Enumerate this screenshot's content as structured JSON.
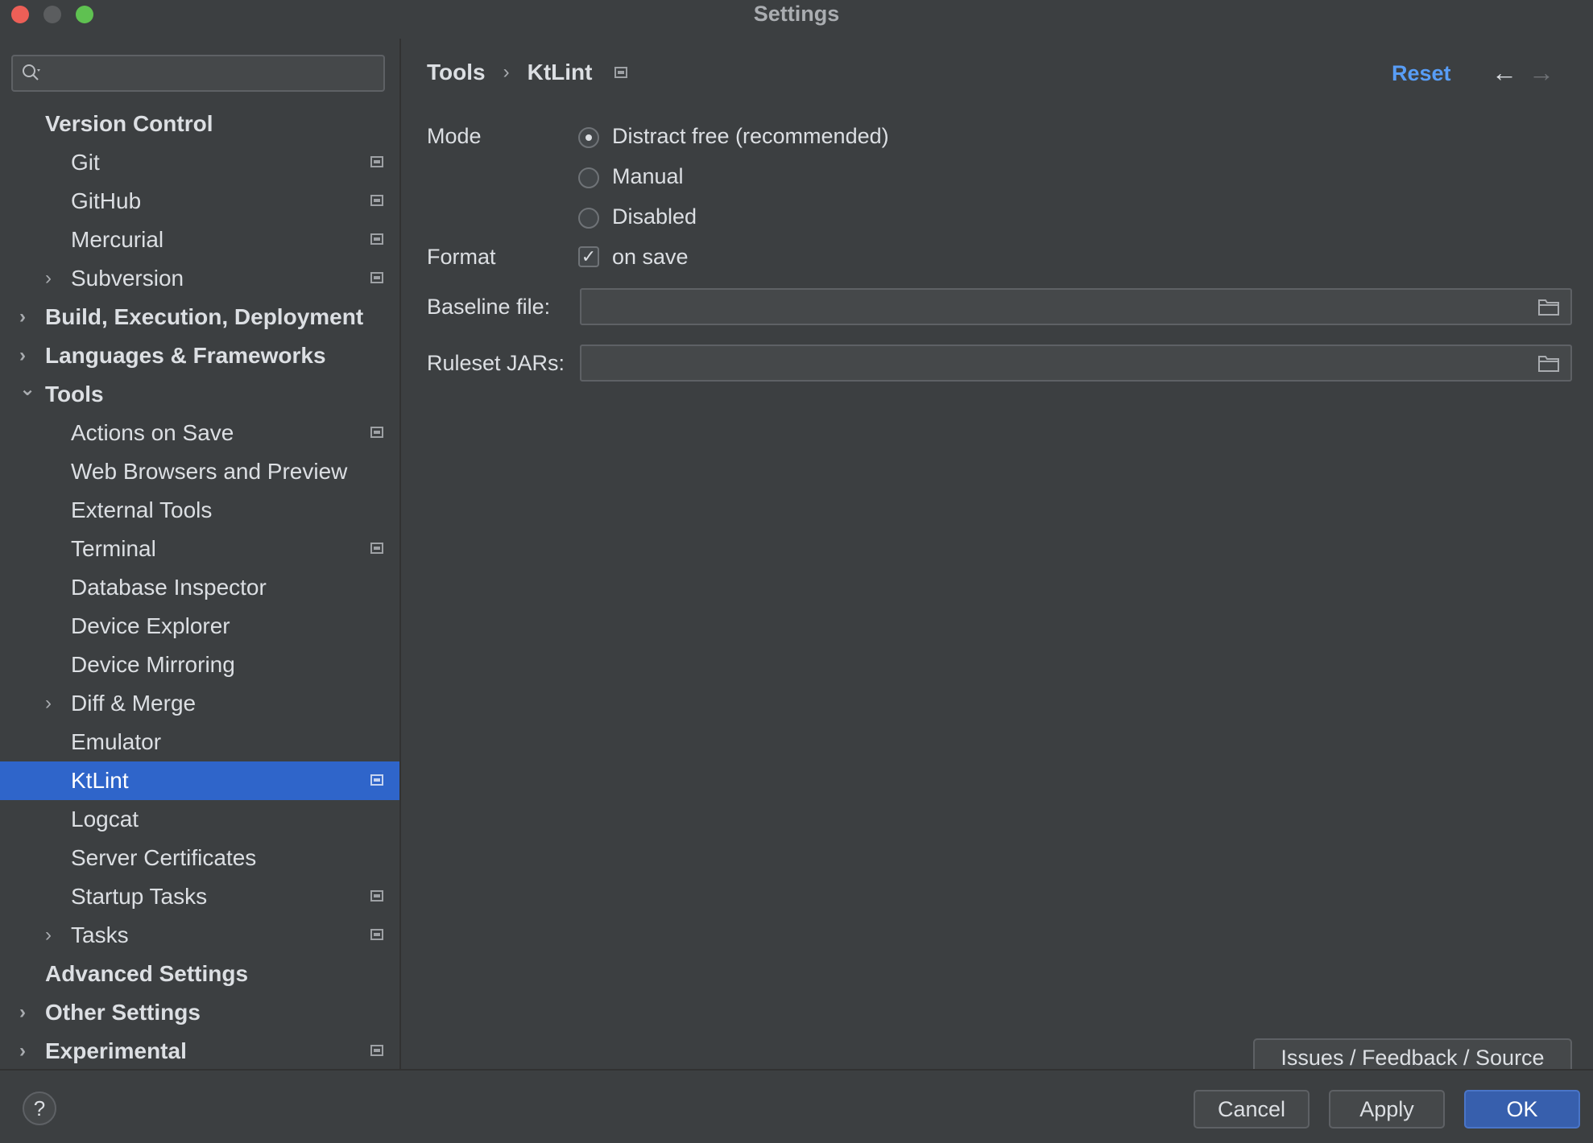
{
  "window": {
    "title": "Settings"
  },
  "search": {
    "placeholder": ""
  },
  "sidebar": {
    "items": [
      {
        "label": "Version Control",
        "level": 0,
        "chevron": "",
        "project": false
      },
      {
        "label": "Git",
        "level": 1,
        "chevron": "",
        "project": true
      },
      {
        "label": "GitHub",
        "level": 1,
        "chevron": "",
        "project": true
      },
      {
        "label": "Mercurial",
        "level": 1,
        "chevron": "",
        "project": true
      },
      {
        "label": "Subversion",
        "level": 1,
        "chevron": "collapsed",
        "project": true
      },
      {
        "label": "Build, Execution, Deployment",
        "level": 0,
        "chevron": "collapsed",
        "project": false
      },
      {
        "label": "Languages & Frameworks",
        "level": 0,
        "chevron": "collapsed",
        "project": false
      },
      {
        "label": "Tools",
        "level": 0,
        "chevron": "expanded",
        "project": false
      },
      {
        "label": "Actions on Save",
        "level": 1,
        "chevron": "",
        "project": true
      },
      {
        "label": "Web Browsers and Preview",
        "level": 1,
        "chevron": "",
        "project": false
      },
      {
        "label": "External Tools",
        "level": 1,
        "chevron": "",
        "project": false
      },
      {
        "label": "Terminal",
        "level": 1,
        "chevron": "",
        "project": true
      },
      {
        "label": "Database Inspector",
        "level": 1,
        "chevron": "",
        "project": false
      },
      {
        "label": "Device Explorer",
        "level": 1,
        "chevron": "",
        "project": false
      },
      {
        "label": "Device Mirroring",
        "level": 1,
        "chevron": "",
        "project": false
      },
      {
        "label": "Diff & Merge",
        "level": 1,
        "chevron": "collapsed",
        "project": false
      },
      {
        "label": "Emulator",
        "level": 1,
        "chevron": "",
        "project": false
      },
      {
        "label": "KtLint",
        "level": 1,
        "chevron": "",
        "project": true,
        "selected": true
      },
      {
        "label": "Logcat",
        "level": 1,
        "chevron": "",
        "project": false
      },
      {
        "label": "Server Certificates",
        "level": 1,
        "chevron": "",
        "project": false
      },
      {
        "label": "Startup Tasks",
        "level": 1,
        "chevron": "",
        "project": true
      },
      {
        "label": "Tasks",
        "level": 1,
        "chevron": "collapsed",
        "project": true
      },
      {
        "label": "Advanced Settings",
        "level": 0,
        "chevron": "",
        "project": false
      },
      {
        "label": "Other Settings",
        "level": 0,
        "chevron": "collapsed",
        "project": false
      },
      {
        "label": "Experimental",
        "level": 0,
        "chevron": "collapsed",
        "project": true
      }
    ]
  },
  "content": {
    "breadcrumb": {
      "parent": "Tools",
      "separator": "›",
      "current": "KtLint"
    },
    "reset_label": "Reset",
    "nav": {
      "back": "←",
      "forward": "→"
    },
    "mode": {
      "label": "Mode",
      "options": [
        {
          "label": "Distract free (recommended)",
          "checked": true
        },
        {
          "label": "Manual",
          "checked": false
        },
        {
          "label": "Disabled",
          "checked": false
        }
      ]
    },
    "format": {
      "label": "Format",
      "checkbox_label": "on save",
      "checked": true,
      "check_glyph": "✓"
    },
    "baseline": {
      "label": "Baseline file:",
      "value": ""
    },
    "ruleset": {
      "label": "Ruleset JARs:",
      "value": ""
    },
    "issues_button": "Issues / Feedback / Source"
  },
  "footer": {
    "help": "?",
    "cancel": "Cancel",
    "apply": "Apply",
    "ok": "OK"
  },
  "colors": {
    "background": "#3c3f41",
    "selection": "#2f65ca",
    "link": "#589df6",
    "ok_button": "#375fad"
  }
}
